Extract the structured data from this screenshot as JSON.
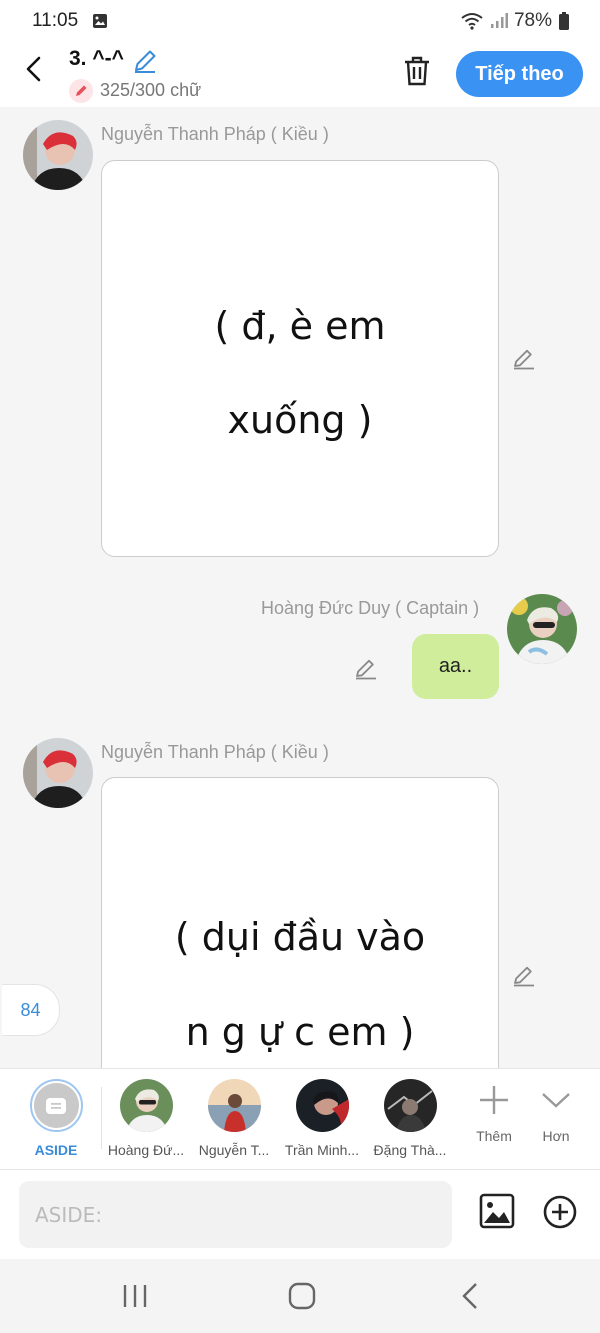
{
  "status_bar": {
    "time": "11:05",
    "battery": "78%"
  },
  "header": {
    "title": "3. ^-^",
    "char_count": "325/300 chữ",
    "next_label": "Tiếp theo"
  },
  "messages": [
    {
      "author": "Nguyễn Thanh Pháp ( Kiều )",
      "lines": [
        "( đ, è em",
        "xuống )"
      ]
    },
    {
      "author": "Hoàng Đức Duy ( Captain )",
      "text": "aa.."
    },
    {
      "author": "Nguyễn Thanh Pháp ( Kiều )",
      "lines": [
        "( dụi đầu vào",
        "n g ự c em )"
      ]
    }
  ],
  "counter": "84",
  "speakers": [
    {
      "label": "ASIDE",
      "icon": "aside-icon"
    },
    {
      "label": "Hoàng Đứ..."
    },
    {
      "label": "Nguyễn T..."
    },
    {
      "label": "Trần Minh..."
    },
    {
      "label": "Đặng Thà..."
    }
  ],
  "controls": {
    "more_label": "Thêm",
    "expand_label": "Hơn"
  },
  "input": {
    "placeholder": "ASIDE:"
  },
  "colors": {
    "accent": "#3a92f2",
    "bubble": "#cfed9b",
    "aside_label": "#3a8bd8"
  }
}
